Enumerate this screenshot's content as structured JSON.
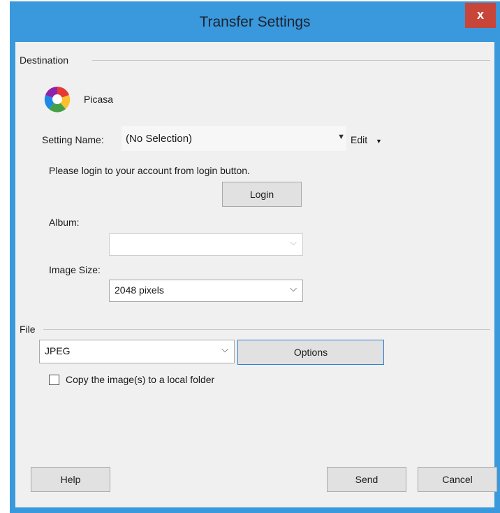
{
  "window": {
    "title": "Transfer Settings",
    "close_label": "x"
  },
  "destination": {
    "group_label": "Destination",
    "service_name": "Picasa",
    "service_icon": "picasa-icon",
    "setting_name_label": "Setting Name:",
    "setting_name_value": "(No Selection)",
    "edit_label": "Edit",
    "login_message": "Please login to your account from login button.",
    "login_button": "Login",
    "album_label": "Album:",
    "album_value": "",
    "image_size_label": "Image Size:",
    "image_size_value": "2048 pixels"
  },
  "file": {
    "group_label": "File",
    "format_value": "JPEG",
    "options_button": "Options",
    "copy_checkbox_label": "Copy the image(s) to a local folder",
    "copy_checked": false
  },
  "footer": {
    "help_button": "Help",
    "send_button": "Send",
    "cancel_button": "Cancel"
  },
  "colors": {
    "title_bar": "#3a98dc",
    "close_button": "#c8453a",
    "client_bg": "#f0f0f0",
    "focus_border": "#2f7fd0"
  }
}
